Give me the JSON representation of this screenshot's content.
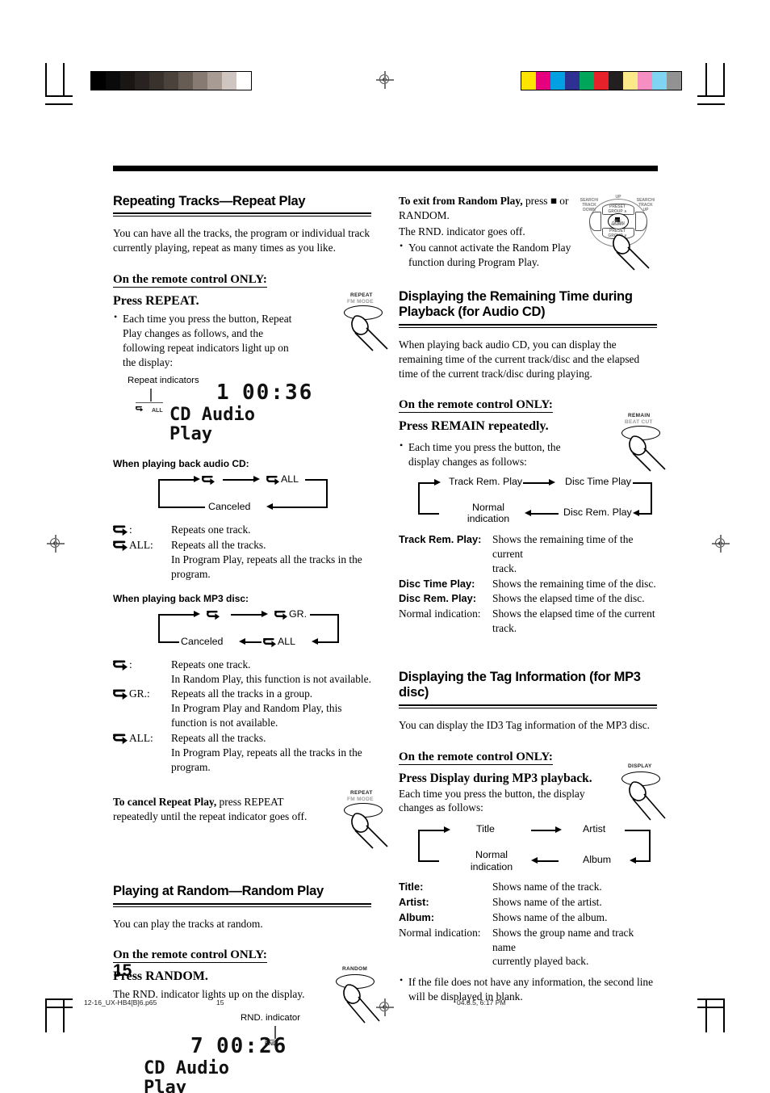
{
  "page": {
    "number": "15",
    "footer": {
      "file": "12-16_UX-HB4[B]6.p65",
      "page": "15",
      "date": "04.8.5, 6:17 PM"
    }
  },
  "left_column": {
    "section1": {
      "heading": "Repeating Tracks—Repeat Play",
      "intro": "You can have all the tracks, the program or individual track currently playing, repeat as many times as you like.",
      "remote_only": "On the remote control ONLY:",
      "press": "Press REPEAT.",
      "bullet1": "Each time you press the button, Repeat Play changes as follows, and the following repeat indicators light up on the display:",
      "button_illustration": {
        "label_top": "REPEAT",
        "label_bottom": "FM MODE"
      },
      "display": {
        "indicator_caption": "Repeat indicators",
        "indicator_chip": "ALL",
        "track": "1",
        "time": "00:36",
        "line1": "CD Audio",
        "line2": "Play"
      },
      "audio_cd": {
        "caption": "When playing back audio CD:",
        "flow_nodes": [
          "",
          "ALL",
          "Canceled"
        ],
        "defs": [
          {
            "key": ":",
            "icon": "repeat-icon",
            "lines": [
              "Repeats one track."
            ]
          },
          {
            "key": "ALL:",
            "icon": "repeat-icon",
            "lines": [
              "Repeats all the tracks.",
              "In Program Play, repeats all the tracks in the",
              "program."
            ]
          }
        ]
      },
      "mp3_disc": {
        "caption": "When playing back MP3 disc:",
        "flow_nodes": [
          "",
          "GR.",
          "ALL",
          "Canceled"
        ],
        "defs": [
          {
            "key": ":",
            "icon": "repeat-icon",
            "lines": [
              "Repeats one track.",
              "In Random Play, this function is not available."
            ]
          },
          {
            "key": "GR.:",
            "icon": "repeat-icon",
            "lines": [
              "Repeats all the tracks in a group.",
              "In Program Play and Random Play, this",
              "function is not available."
            ]
          },
          {
            "key": "ALL:",
            "icon": "repeat-icon",
            "lines": [
              "Repeats all the tracks.",
              "In Program Play, repeats all the tracks in the",
              "program."
            ]
          }
        ]
      },
      "cancel_bold": "To cancel Repeat Play,",
      "cancel_rest": " press REPEAT repeatedly until the repeat indicator goes off.",
      "cancel_button": {
        "label_top": "REPEAT",
        "label_bottom": "FM MODE"
      }
    },
    "section2": {
      "heading": "Playing at Random—Random Play",
      "intro": "You can play the tracks at random.",
      "remote_only": "On the remote control ONLY:",
      "press": "Press RANDOM.",
      "note": "The RND. indicator lights up on the display.",
      "button_illustration": {
        "label_top": "RANDOM",
        "label_bottom": ""
      },
      "display": {
        "indicator_caption": "RND. indicator",
        "indicator_chip": "RND.",
        "track": "7",
        "time": "00:26",
        "line1": "CD Audio",
        "line2": "Play"
      }
    }
  },
  "right_column": {
    "exit_random": {
      "bold": "To exit from Random Play,",
      "rest": " press ■ or RANDOM.",
      "line2": "The RND. indicator goes off.",
      "bullet": "You cannot activate the Random Play function during Program Play.",
      "dpad": {
        "up": "UP",
        "top_seg": "PRESET\nGROUP ∧",
        "bottom_seg": "PRESET\nGROUP ∨",
        "down": "DOWN",
        "left_top": "SEARCH/\nTRACK\nDOWN",
        "right_top": "SEARCH/\nTRACK\nUP",
        "center": "SET/\nSELECT"
      }
    },
    "section3": {
      "heading": "Displaying the Remaining Time during Playback (for Audio CD)",
      "intro": "When playing back audio CD, you can display the remaining time of the current track/disc and the elapsed time of the current track/disc during playing.",
      "remote_only": "On the remote control ONLY:",
      "press": "Press REMAIN repeatedly.",
      "bullet": "Each time you press the button, the display changes as follows:",
      "button_illustration": {
        "label_top": "REMAIN",
        "label_bottom": "BEAT CUT"
      },
      "flow_nodes": [
        "Track Rem. Play",
        "Disc Time Play",
        "Disc Rem. Play",
        "Normal indication"
      ],
      "defs": [
        {
          "key": "Track Rem. Play:",
          "bold": true,
          "lines": [
            "Shows the remaining time of the current",
            "track."
          ]
        },
        {
          "key": "Disc Time Play:",
          "bold": true,
          "lines": [
            "Shows the remaining time of the disc."
          ]
        },
        {
          "key": "Disc Rem. Play:",
          "bold": true,
          "lines": [
            "Shows the elapsed time of the disc."
          ]
        },
        {
          "key": "Normal indication:",
          "bold": false,
          "lines": [
            "Shows the elapsed time of the current",
            "track."
          ]
        }
      ]
    },
    "section4": {
      "heading": "Displaying the Tag Information (for MP3 disc)",
      "intro": "You can display the ID3 Tag information of the MP3 disc.",
      "remote_only": "On the remote control ONLY:",
      "press": "Press Display during MP3 playback.",
      "note": "Each time you press the button, the display changes as follows:",
      "button_illustration": {
        "label_top": "DISPLAY",
        "label_bottom": ""
      },
      "flow_nodes": [
        "Title",
        "Artist",
        "Album",
        "Normal indication"
      ],
      "defs": [
        {
          "key": "Title:",
          "bold": true,
          "lines": [
            "Shows name of the track."
          ]
        },
        {
          "key": "Artist:",
          "bold": true,
          "lines": [
            "Shows name of the artist."
          ]
        },
        {
          "key": "Album:",
          "bold": true,
          "lines": [
            "Shows name of the album."
          ]
        },
        {
          "key": "Normal indication:",
          "bold": false,
          "lines": [
            "Shows the group name and track name",
            "currently played back."
          ]
        }
      ],
      "bullet": "If the file does not have any information, the second line will be displayed in blank."
    }
  },
  "print_marks": {
    "gray_wedge": [
      "#000000",
      "#0b0a0a",
      "#191614",
      "#282320",
      "#38312c",
      "#4b423c",
      "#675c54",
      "#877a72",
      "#a89b94",
      "#cfc6c1",
      "#ffffff"
    ],
    "color_wedge": [
      "#ffe400",
      "#e6007e",
      "#00a0e3",
      "#2e3192",
      "#00a65a",
      "#e62129",
      "#231f20",
      "#fbe98a",
      "#f58fc2",
      "#7fd4f2",
      "#929292"
    ]
  }
}
